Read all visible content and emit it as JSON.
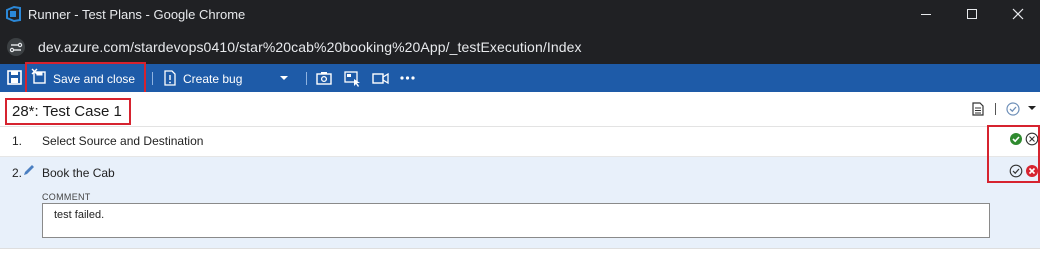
{
  "window": {
    "title": "Runner - Test Plans - Google Chrome",
    "url": "dev.azure.com/stardevops0410/star%20cab%20booking%20App/_testExecution/Index"
  },
  "toolbar": {
    "save_close_label": "Save and close",
    "create_bug_label": "Create bug",
    "icons": [
      "save-icon",
      "save-close-icon",
      "bug-icon",
      "dropdown-icon",
      "screenshot-icon",
      "capture-actions-icon",
      "record-video-icon",
      "more-icon"
    ]
  },
  "test_case": {
    "title": "28*: Test Case 1"
  },
  "steps": [
    {
      "number": "1.",
      "text": "Select Source and Destination",
      "status": "passed"
    },
    {
      "number": "2.",
      "text": "Book the Cab",
      "status": "failed"
    }
  ],
  "comment": {
    "label": "COMMENT",
    "value": "test failed."
  },
  "colors": {
    "toolbar": "#1e5ba8",
    "pass": "#2f8a2f",
    "fail": "#d6232f",
    "highlight": "#d6232f",
    "selected_row": "#e8f0fa"
  }
}
